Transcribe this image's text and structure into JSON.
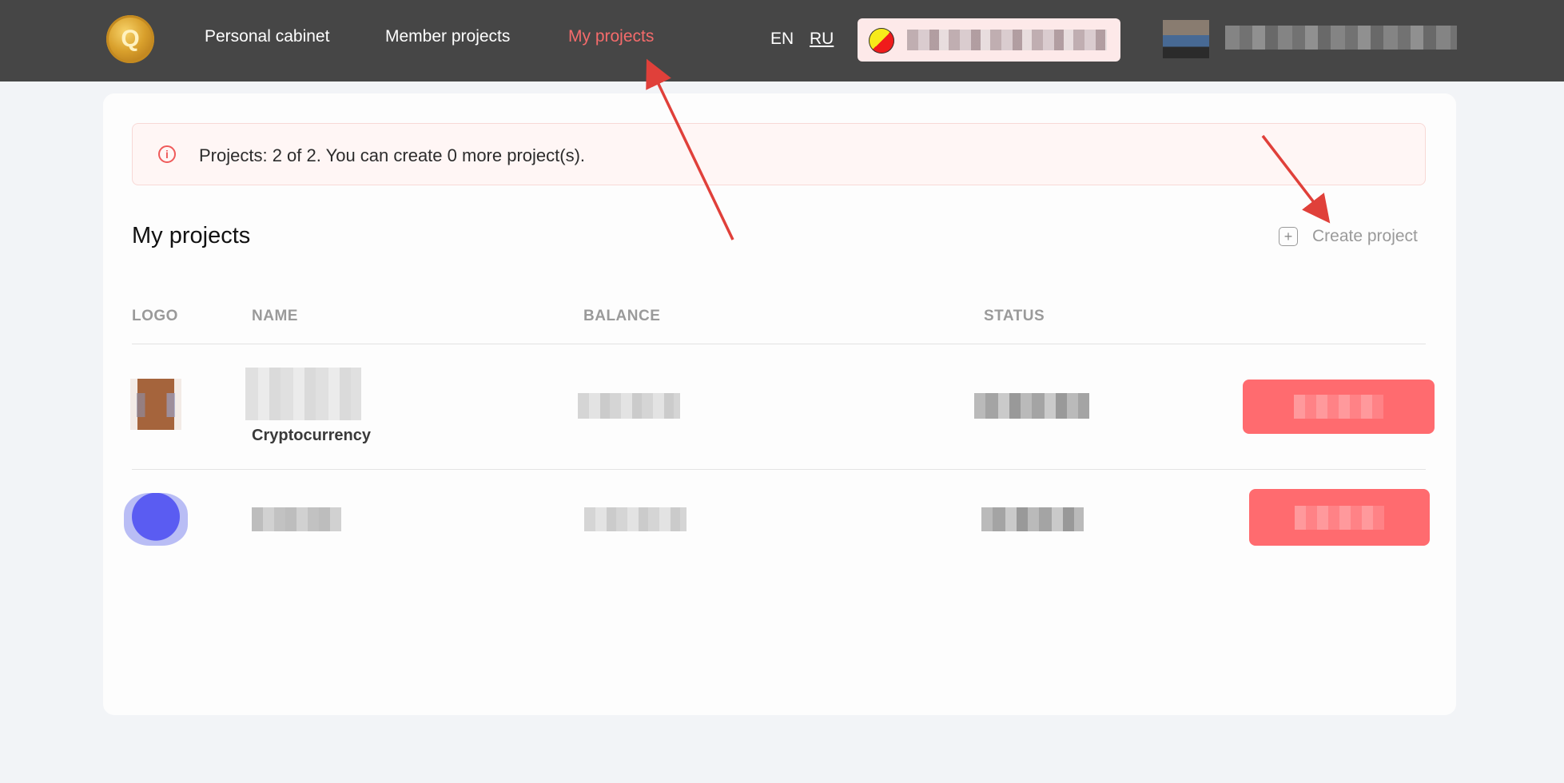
{
  "header": {
    "logo_letter": "Q",
    "nav": [
      {
        "label": "Personal cabinet"
      },
      {
        "label": "Member projects"
      },
      {
        "label": "My projects",
        "active": true
      }
    ],
    "languages": [
      {
        "label": "EN"
      },
      {
        "label": "RU",
        "selected": true
      }
    ]
  },
  "alert": {
    "icon": "info-icon",
    "text": "Projects: 2 of 2. You can create 0 more project(s)."
  },
  "main": {
    "title": "My projects",
    "create_button": {
      "icon": "plus-icon",
      "label": "Create project"
    },
    "table": {
      "columns": [
        "LOGO",
        "NAME",
        "BALANCE",
        "STATUS"
      ],
      "rows": [
        {
          "category": "Cryptocurrency"
        },
        {
          "category": ""
        }
      ]
    }
  },
  "colors": {
    "header_bg": "#464646",
    "accent": "#f46b6b",
    "action_button": "#ff6b6f",
    "annotation_arrow": "#e0403a"
  }
}
